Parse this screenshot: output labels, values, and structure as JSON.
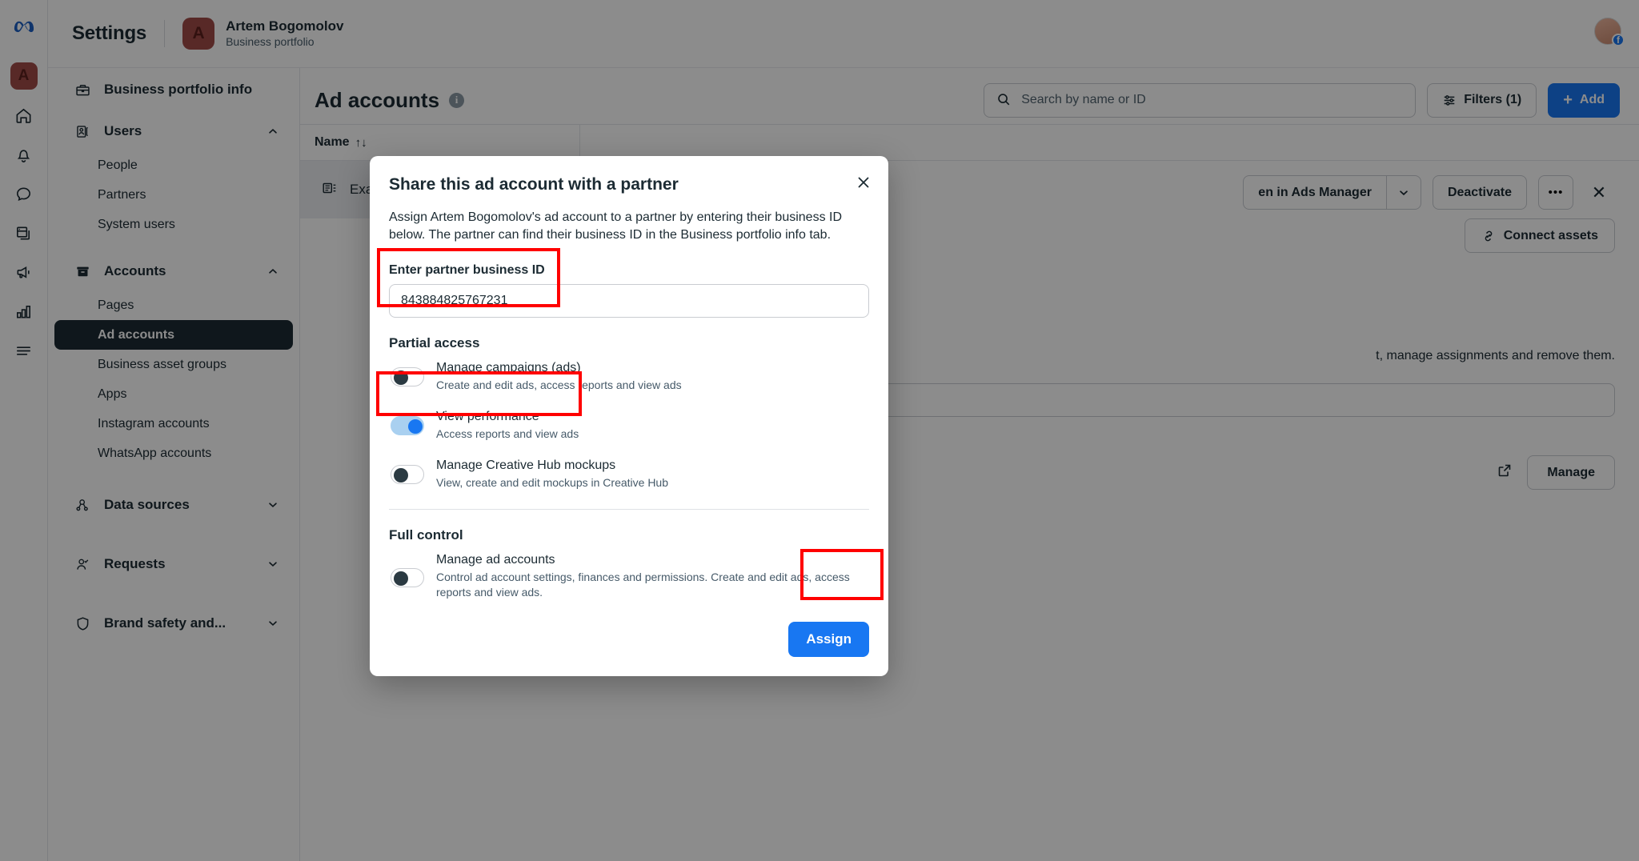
{
  "rail": {
    "logo": "meta-logo",
    "avatar_letter": "A",
    "items": [
      {
        "name": "home-icon",
        "label": "Home"
      },
      {
        "name": "notifications-bell-icon",
        "label": "Notifications"
      },
      {
        "name": "chat-bubble-icon",
        "label": "Inbox"
      },
      {
        "name": "pages-icon",
        "label": "Pages"
      },
      {
        "name": "megaphone-icon",
        "label": "Ads"
      },
      {
        "name": "bar-chart-icon",
        "label": "Insights"
      },
      {
        "name": "hamburger-menu-icon",
        "label": "All tools"
      }
    ]
  },
  "header": {
    "title": "Settings",
    "business_initial": "A",
    "business_name": "Artem Bogomolov",
    "business_subtitle": "Business portfolio"
  },
  "sidebar": {
    "groups": [
      {
        "label": "Business portfolio info",
        "icon": "briefcase-icon",
        "expandable": false,
        "items": []
      },
      {
        "label": "Users",
        "icon": "users-badge-icon",
        "expandable": true,
        "chevron": "chevron-up",
        "items": [
          {
            "label": "People",
            "selected": false
          },
          {
            "label": "Partners",
            "selected": false
          },
          {
            "label": "System users",
            "selected": false
          }
        ]
      },
      {
        "label": "Accounts",
        "icon": "archive-box-icon",
        "expandable": true,
        "chevron": "chevron-up",
        "items": [
          {
            "label": "Pages",
            "selected": false
          },
          {
            "label": "Ad accounts",
            "selected": true
          },
          {
            "label": "Business asset groups",
            "selected": false
          },
          {
            "label": "Apps",
            "selected": false
          },
          {
            "label": "Instagram accounts",
            "selected": false
          },
          {
            "label": "WhatsApp accounts",
            "selected": false
          }
        ]
      },
      {
        "label": "Data sources",
        "icon": "data-sources-icon",
        "expandable": true,
        "chevron": "chevron-down",
        "items": []
      },
      {
        "label": "Requests",
        "icon": "person-check-icon",
        "expandable": true,
        "chevron": "chevron-down",
        "items": []
      },
      {
        "label": "Brand safety and...",
        "icon": "shield-icon",
        "expandable": true,
        "chevron": "chevron-down",
        "items": []
      }
    ]
  },
  "content": {
    "page_title": "Ad accounts",
    "info_glyph": "i",
    "search_placeholder": "Search by name or ID",
    "filters_label": "Filters (1)",
    "add_label": "Add",
    "add_glyph": "+",
    "column_name": "Name",
    "sort_glyph": "↑↓",
    "row_name": "Exa",
    "detail_title": "Exa",
    "open_in_ads_manager_label": "en in Ads Manager",
    "deactivate_label": "Deactivate",
    "more_label": "•••",
    "close_label": "✕",
    "connect_assets_label": "Connect assets",
    "detail_description": "t, manage assignments and remove them.",
    "manage_label": "Manage"
  },
  "modal": {
    "title": "Share this ad account with a partner",
    "description": "Assign Artem Bogomolov's ad account to a partner by entering their business ID below. The partner can find their business ID in the Business portfolio info tab.",
    "field_label": "Enter partner business ID",
    "business_id_value": "843884825767231",
    "business_id_placeholder": "Enter partner business ID",
    "partial_access_heading": "Partial access",
    "full_control_heading": "Full control",
    "partial_permissions": [
      {
        "title": "Manage campaigns (ads)",
        "subtitle": "Create and edit ads, access reports and view ads",
        "enabled": false,
        "highlighted": false
      },
      {
        "title": "View performance",
        "subtitle": "Access reports and view ads",
        "enabled": true,
        "highlighted": true
      },
      {
        "title": "Manage Creative Hub mockups",
        "subtitle": "View, create and edit mockups in Creative Hub",
        "enabled": false,
        "highlighted": false
      }
    ],
    "full_permissions": [
      {
        "title": "Manage ad accounts",
        "subtitle": "Control ad account settings, finances and permissions. Create and edit ads, access reports and view ads.",
        "enabled": false,
        "highlighted": false
      }
    ],
    "assign_label": "Assign",
    "close_glyph": "✕"
  },
  "annotations": {
    "highlight_color": "#ff0000",
    "boxes": [
      "business-id-field",
      "view-performance-toggle",
      "assign-button"
    ]
  }
}
